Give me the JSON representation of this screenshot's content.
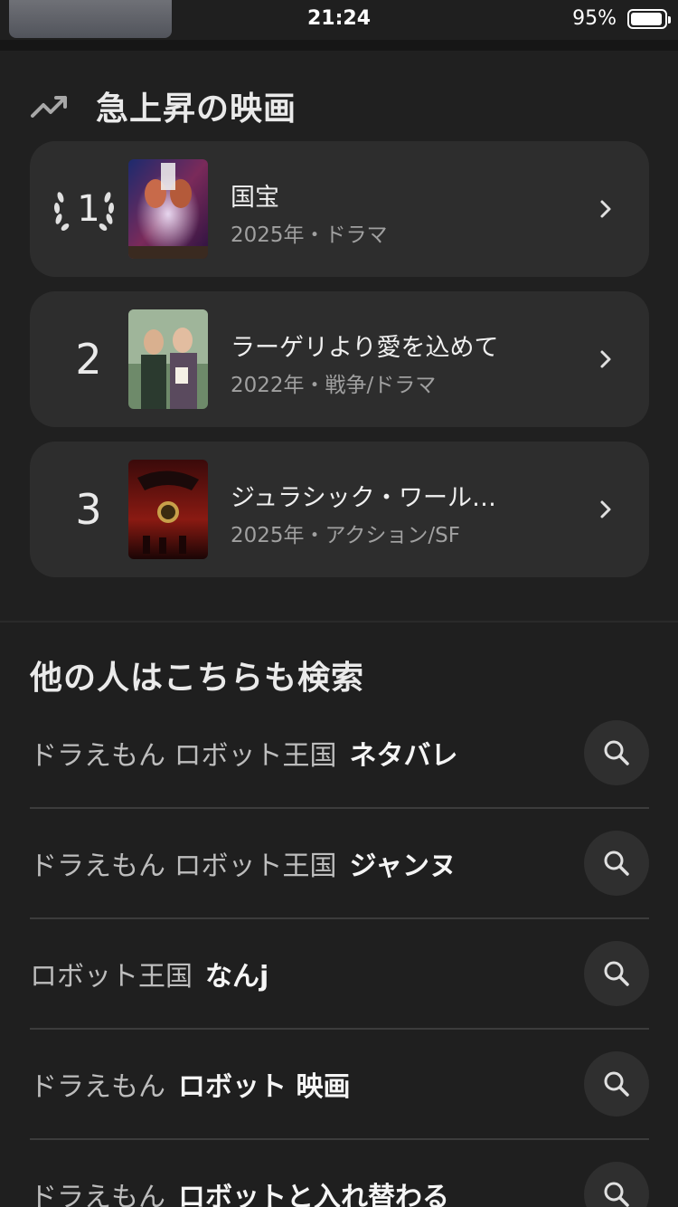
{
  "status_bar": {
    "time": "21:24",
    "battery": "95%",
    "battery_level": 0.95
  },
  "trending": {
    "title": "急上昇の映画",
    "items": [
      {
        "rank": "1",
        "title": "国宝",
        "meta": "2025年・ドラマ",
        "poster": "poster-kokuho"
      },
      {
        "rank": "2",
        "title": "ラーゲリより愛を込めて",
        "meta": "2022年・戦争/ドラマ",
        "poster": "poster-lageri"
      },
      {
        "rank": "3",
        "title": "ジュラシック・ワール…",
        "meta": "2025年・アクション/SF",
        "poster": "poster-jurassic"
      }
    ]
  },
  "related": {
    "title": "他の人はこちらも検索",
    "items": [
      {
        "plain": "ドラえもん ロボット王国",
        "bold": "ネタバレ"
      },
      {
        "plain": "ドラえもん ロボット王国",
        "bold": "ジャンヌ"
      },
      {
        "plain": "ロボット王国",
        "bold": "なんj"
      },
      {
        "plain": "ドラえもん",
        "bold": "ロボット 映画"
      },
      {
        "plain": "ドラえもん",
        "bold": "ロボットと入れ替わる"
      }
    ]
  },
  "icons": {
    "trending": "trending-up-icon",
    "chevron": "chevron-right-icon",
    "search": "search-icon",
    "laurel": "laurel-wreath-icon"
  },
  "colors": {
    "background": "#1f1f1f",
    "card": "#2d2d2d",
    "text": "#eaeaea",
    "muted": "#a0a0a0"
  }
}
